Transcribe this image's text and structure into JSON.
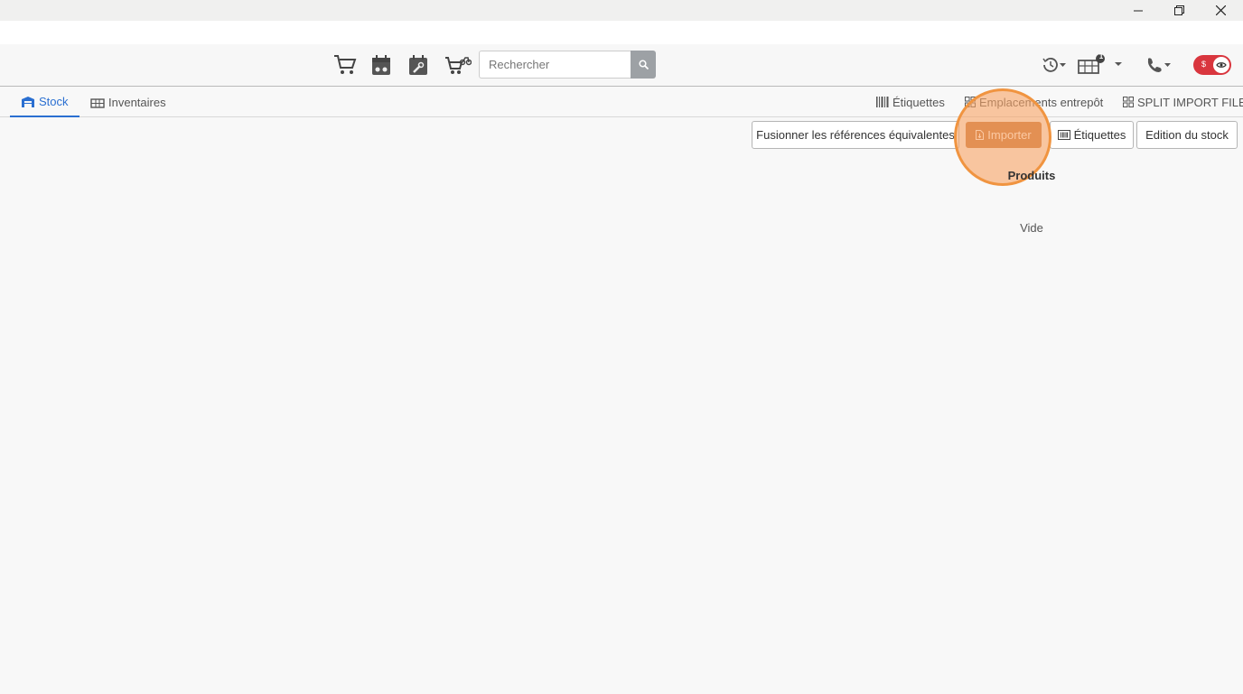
{
  "window": {
    "minimize_icon": "minimize-icon",
    "restore_icon": "restore-icon",
    "close_icon": "close-icon"
  },
  "navbar": {
    "icons": [
      "cart-icon",
      "calendar-moto-icon",
      "calendar-wrench-icon",
      "cart-moto-icon"
    ],
    "search": {
      "placeholder": "Rechercher",
      "value": ""
    },
    "right_icons": [
      "history-icon",
      "warehouse-icon",
      "phone-icon",
      "toggle-icon"
    ],
    "badge": "1",
    "toggle": {
      "label": "$",
      "color": "#d9363e"
    }
  },
  "tabs": {
    "left": [
      {
        "label": "Stock",
        "icon": "store-icon",
        "active": true
      },
      {
        "label": "Inventaires",
        "icon": "inventory-icon",
        "active": false
      }
    ],
    "right": [
      {
        "label": "Étiquettes",
        "icon": "barcode-icon"
      },
      {
        "label": "Emplacements entrepôt",
        "icon": "grid-icon"
      },
      {
        "label": "SPLIT IMPORT FILE",
        "icon": "grid-icon"
      }
    ]
  },
  "toolbar": {
    "merge_label": "Fusionner les références équivalentes",
    "import_label": "Importer",
    "labels_label": "Étiquettes",
    "edit_label": "Edition du stock"
  },
  "content": {
    "section_title": "Produits",
    "empty_text": "Vide"
  },
  "colors": {
    "accent": "#2a6fd1",
    "import_button": "#c4743a",
    "highlight": "#f09440"
  }
}
